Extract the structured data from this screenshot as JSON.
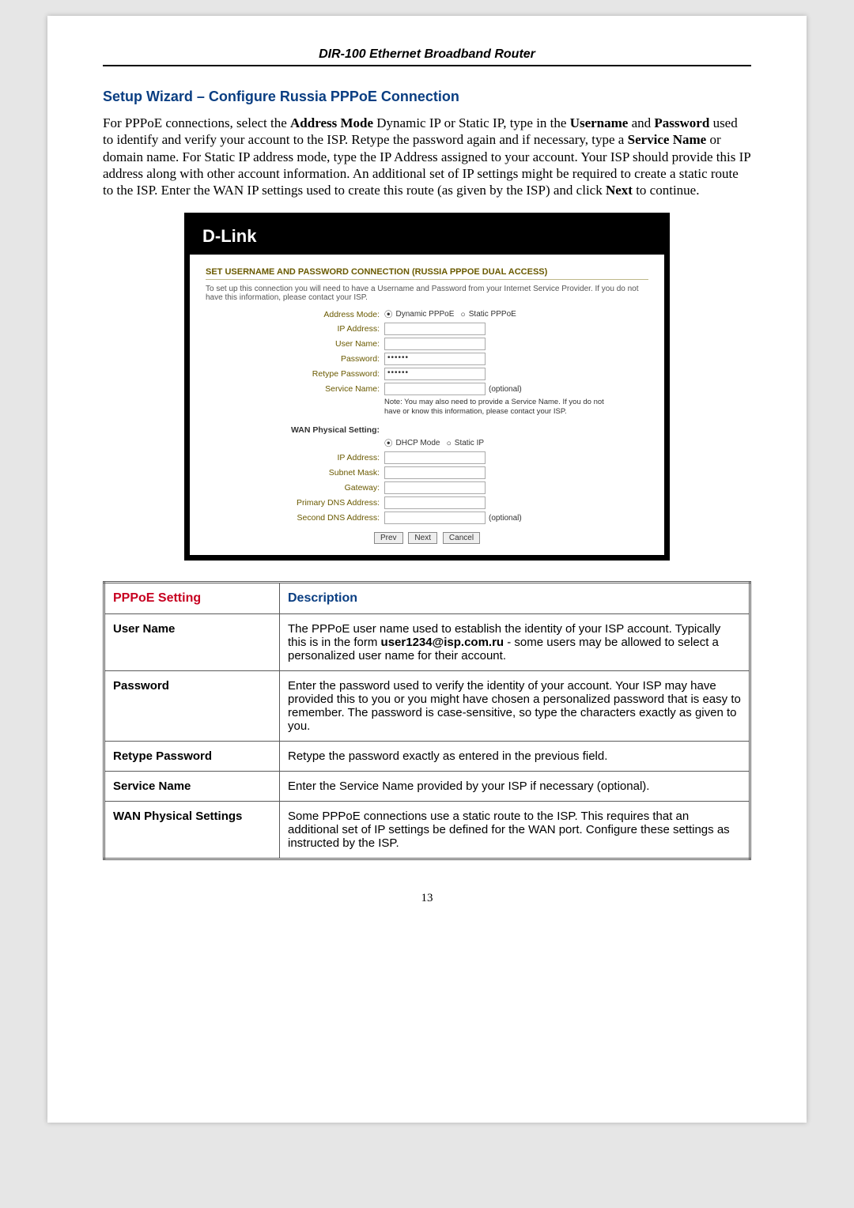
{
  "doc_header": "DIR-100 Ethernet Broadband Router",
  "section_title": "Setup Wizard – Configure Russia PPPoE Connection",
  "intro": {
    "p1a": "For PPPoE connections, select the ",
    "p1b": "Address Mode",
    "p1c": " Dynamic IP or Static IP, type in the ",
    "p1d": "Username",
    "p1e": " and ",
    "p1f": "Password",
    "p1g": " used to identify and verify your account to the ISP. Retype the password again and if necessary, type a ",
    "p1h": "Service Name",
    "p1i": " or domain name. For Static IP address mode, type the IP Address assigned to your account. Your ISP should provide this IP address along with other account information. An additional set of IP settings might be required to create a static route to the ISP. Enter the WAN IP settings used to create this route (as given by the ISP) and click ",
    "p1j": "Next",
    "p1k": " to continue."
  },
  "shot": {
    "brand": "D-Link",
    "panel_title": "SET USERNAME AND PASSWORD CONNECTION (RUSSIA PPPOE DUAL ACCESS)",
    "note": "To set up this connection you will need to have a Username and Password from your Internet Service Provider. If you do not have this information, please contact your ISP.",
    "labels": {
      "addr_mode": "Address Mode:",
      "dyn": "Dynamic PPPoE",
      "stat": "Static PPPoE",
      "ip": "IP Address:",
      "user": "User Name:",
      "pw": "Password:",
      "rpw": "Retype Password:",
      "svc": "Service Name:",
      "opt": "(optional)",
      "subnote": "Note: You may also need to provide a Service Name. If you do not have or know this information, please contact your ISP.",
      "wan_title": "WAN Physical Setting:",
      "dhcp": "DHCP Mode",
      "statip": "Static IP",
      "subnet": "Subnet Mask:",
      "gw": "Gateway:",
      "pdns": "Primary DNS Address:",
      "sdns": "Second DNS Address:"
    },
    "values": {
      "pw": "••••••",
      "rpw": "••••••"
    },
    "buttons": {
      "prev": "Prev",
      "next": "Next",
      "cancel": "Cancel"
    }
  },
  "table": {
    "h1": "PPPoE Setting",
    "h2": "Description",
    "rows": [
      {
        "name": "User Name",
        "desc_a": "The PPPoE user name used to establish the identity of your ISP account. Typically this is in the form ",
        "desc_b": "user1234@isp.com.ru",
        "desc_c": " - some users may be allowed to select a personalized user name for their account."
      },
      {
        "name": "Password",
        "desc_a": "Enter the password used to verify the identity of your account. Your ISP may have provided this to you or you might have chosen a personalized password that is easy to remember. The password is case-sensitive, so type the characters exactly as given to you.",
        "desc_b": "",
        "desc_c": ""
      },
      {
        "name": "Retype Password",
        "desc_a": "Retype the password exactly as entered in the previous field.",
        "desc_b": "",
        "desc_c": ""
      },
      {
        "name": "Service Name",
        "desc_a": "Enter the Service Name provided by your ISP if necessary (optional).",
        "desc_b": "",
        "desc_c": ""
      },
      {
        "name": "WAN Physical Settings",
        "desc_a": "Some PPPoE connections use a static route to the ISP. This requires that an additional set of IP settings be defined for the WAN port. Configure these settings as instructed by the ISP.",
        "desc_b": "",
        "desc_c": ""
      }
    ]
  },
  "page_number": "13"
}
